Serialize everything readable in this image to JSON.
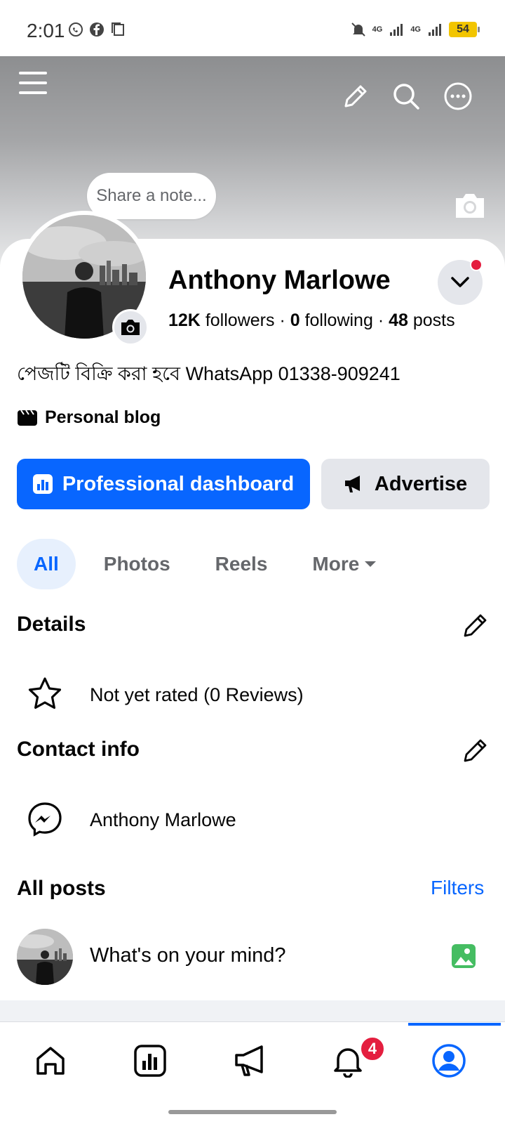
{
  "status_bar": {
    "time": "2:01",
    "battery": "54",
    "network_1": "4G",
    "network_2": "4G"
  },
  "cover": {
    "menu_icon": "menu-icon",
    "edit_icon": "pencil-icon",
    "search_icon": "search-icon",
    "more_icon": "more-horizontal-icon",
    "camera_icon": "camera-icon"
  },
  "note": {
    "placeholder": "Share a note..."
  },
  "profile": {
    "name": "Anthony Marlowe",
    "followers_count": "12K",
    "followers_label": "followers",
    "following_count": "0",
    "following_label": "following",
    "posts_count": "48",
    "posts_label": "posts",
    "separator": "·",
    "bio": "পেজটি বিক্রি করা হবে WhatsApp 01338-909241",
    "category": "Personal blog"
  },
  "actions": {
    "professional_dashboard": "Professional dashboard",
    "advertise": "Advertise"
  },
  "tabs": [
    {
      "label": "All",
      "active": true
    },
    {
      "label": "Photos",
      "active": false
    },
    {
      "label": "Reels",
      "active": false
    },
    {
      "label": "More",
      "active": false
    }
  ],
  "details": {
    "title": "Details",
    "rating_text": "Not yet rated (0 Reviews)"
  },
  "contact": {
    "title": "Contact info",
    "messenger_name": "Anthony Marlowe"
  },
  "posts": {
    "title": "All posts",
    "filters_label": "Filters",
    "composer_placeholder": "What's on your mind?"
  },
  "bottom_nav": {
    "items": [
      "home",
      "dashboard",
      "ads",
      "notifications",
      "profile"
    ],
    "notifications_badge": "4",
    "active": "profile"
  },
  "colors": {
    "accent": "#0866ff",
    "badge": "#e41e3f",
    "secondary_button": "#e4e6eb",
    "photo_green": "#45bd62"
  }
}
